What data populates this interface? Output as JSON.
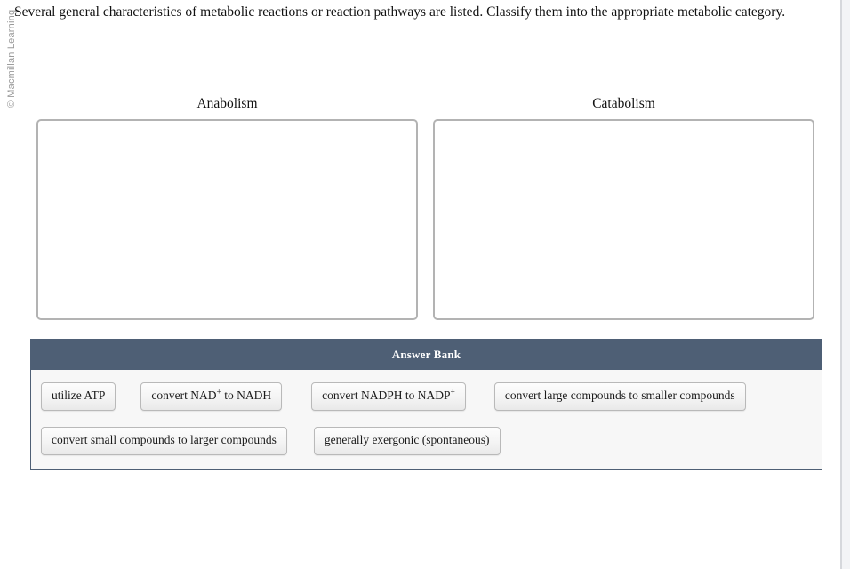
{
  "watermark": {
    "text": "© Macmillan Learning"
  },
  "prompt": {
    "text": "Several general characteristics of metabolic reactions or reaction pathways are listed. Classify them into the appropriate metabolic category."
  },
  "zones": [
    {
      "title": "Anabolism",
      "items": []
    },
    {
      "title": "Catabolism",
      "items": []
    }
  ],
  "answer_bank": {
    "header": "Answer Bank",
    "rows": [
      [
        {
          "prefix": "utilize ATP",
          "sup": "",
          "suffix": ""
        },
        {
          "prefix": "convert NAD",
          "sup": "+",
          "suffix": " to NADH"
        },
        {
          "prefix": "convert NADPH to NADP",
          "sup": "+",
          "suffix": ""
        },
        {
          "prefix": "convert large compounds to smaller compounds",
          "sup": "",
          "suffix": ""
        }
      ],
      [
        {
          "prefix": "convert small compounds to larger compounds",
          "sup": "",
          "suffix": ""
        },
        {
          "prefix": "generally exergonic (spontaneous)",
          "sup": "",
          "suffix": ""
        }
      ]
    ]
  },
  "colors": {
    "bank_header_bg": "#4e5f75",
    "bank_body_bg": "#f7f7f7",
    "zone_border": "#b3b3b3",
    "chip_border": "#b9b9b9",
    "page_bg": "#ffffff",
    "divider": "#d6d8dc"
  }
}
